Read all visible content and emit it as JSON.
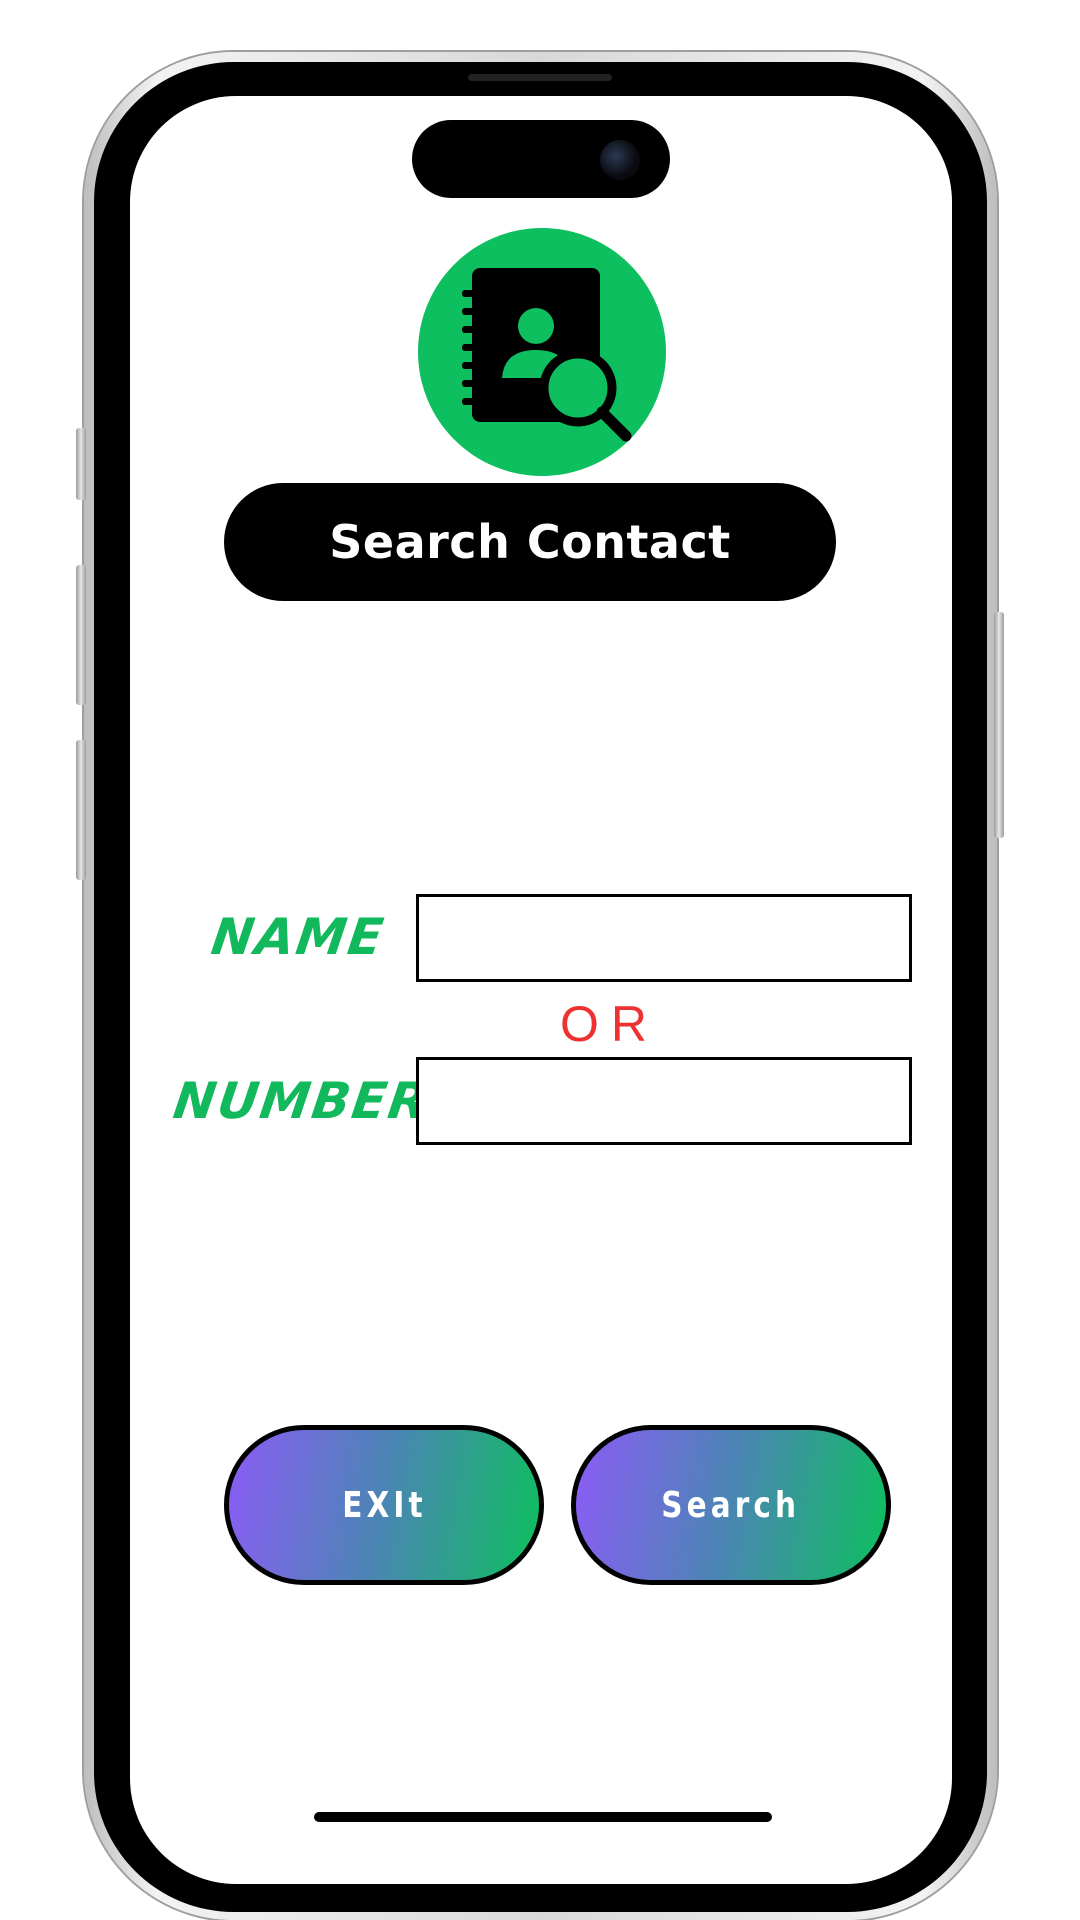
{
  "header": {
    "title": "Search Contact",
    "logo_icon": "contact-book-search-icon"
  },
  "form": {
    "name_label": "NAME",
    "name_value": "",
    "separator": "OR",
    "number_label": "NUMBER",
    "number_value": ""
  },
  "actions": {
    "exit_label": "EXIt",
    "search_label": "Search"
  },
  "colors": {
    "accent_green": "#0dbf5e",
    "separator_red": "#ee3232",
    "gradient_start": "#8b5cf6",
    "gradient_end": "#0dbf5e"
  }
}
